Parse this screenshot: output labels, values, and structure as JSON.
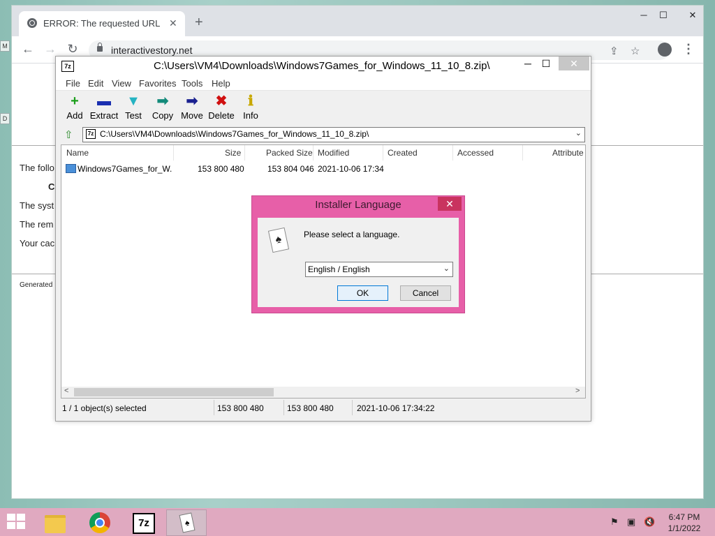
{
  "browser": {
    "tab_title": "ERROR: The requested URL could",
    "new_tab": "+",
    "url": "interactivestory.net",
    "minimize": "─",
    "maximize": "☐",
    "close": "✕",
    "page_lines": [
      "The follo",
      "C",
      "The syst",
      "The rem",
      "Your cac",
      "Generated"
    ]
  },
  "zip": {
    "icon_text": "7z",
    "title": "C:\\Users\\VM4\\Downloads\\Windows7Games_for_Windows_11_10_8.zip\\",
    "menu": [
      "File",
      "Edit",
      "View",
      "Favorites",
      "Tools",
      "Help"
    ],
    "tools": [
      {
        "label": "Add",
        "icon": "+",
        "color": "#1a9e1a"
      },
      {
        "label": "Extract",
        "icon": "▬",
        "color": "#1a2fb0"
      },
      {
        "label": "Test",
        "icon": "▼",
        "color": "#25b3c2"
      },
      {
        "label": "Copy",
        "icon": "➡",
        "color": "#138a7a"
      },
      {
        "label": "Move",
        "icon": "➡",
        "color": "#1a2090"
      },
      {
        "label": "Delete",
        "icon": "✖",
        "color": "#d01010"
      },
      {
        "label": "Info",
        "icon": "ℹ",
        "color": "#c8a800"
      }
    ],
    "address": "C:\\Users\\VM4\\Downloads\\Windows7Games_for_Windows_11_10_8.zip\\",
    "columns": [
      "Name",
      "Size",
      "Packed Size",
      "Modified",
      "Created",
      "Accessed",
      "Attribute"
    ],
    "row": {
      "name": "Windows7Games_for_W...",
      "size": "153 800 480",
      "packed": "153 804 046",
      "modified": "2021-10-06 17:34"
    },
    "status": {
      "selected": "1 / 1 object(s) selected",
      "size": "153 800 480",
      "packed": "153 800 480",
      "modified": "2021-10-06 17:34:22"
    }
  },
  "dialog": {
    "title": "Installer Language",
    "close": "✕",
    "message": "Please select a language.",
    "language": "English / English",
    "ok": "OK",
    "cancel": "Cancel"
  },
  "taskbar": {
    "zip_label": "7z",
    "time": "6:47 PM",
    "date": "1/1/2022"
  }
}
